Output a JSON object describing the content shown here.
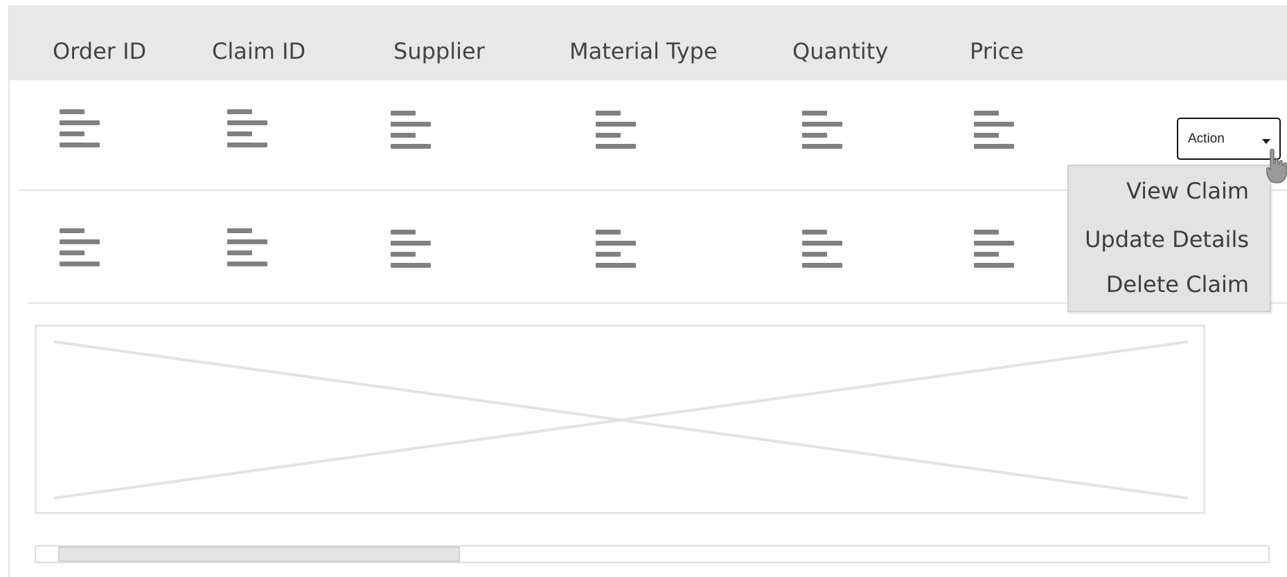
{
  "table": {
    "headers": [
      "Order ID",
      "Claim ID",
      "Supplier",
      "Material Type",
      "Quantity",
      "Price"
    ],
    "rows": [
      {
        "cell_icons": [
          "text-lines-icon",
          "text-lines-icon",
          "text-lines-icon",
          "text-lines-icon",
          "text-lines-icon",
          "text-lines-icon"
        ]
      },
      {
        "cell_icons": [
          "text-lines-icon",
          "text-lines-icon",
          "text-lines-icon",
          "text-lines-icon",
          "text-lines-icon",
          "text-lines-icon"
        ]
      }
    ]
  },
  "action_dropdown": {
    "label": "Action",
    "icon": "caret-down-icon",
    "menu_items": [
      "View Claim",
      "Update Details",
      "Delete Claim"
    ]
  },
  "cursor": {
    "icon": "hand-pointer-icon"
  },
  "image_placeholder": {
    "icon": "image-placeholder-icon"
  },
  "colors": {
    "header_bg": "#e8e8e8",
    "menu_bg": "#e3e3e3",
    "icon_gray": "#808080",
    "border": "#e3e3e3"
  }
}
